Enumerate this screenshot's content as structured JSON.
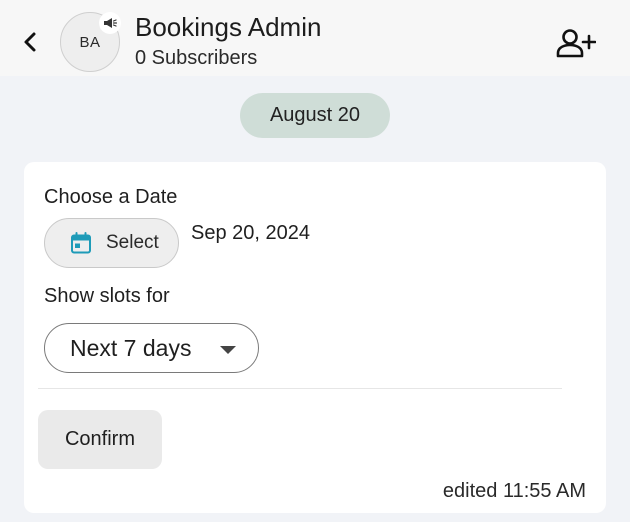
{
  "header": {
    "back_icon": "chevron-left-icon",
    "avatar_initials": "BA",
    "avatar_badge_icon": "megaphone-icon",
    "title": "Bookings Admin",
    "subtitle": "0 Subscribers",
    "add_user_icon": "add-user-icon"
  },
  "date_chip": {
    "label": "August 20"
  },
  "card": {
    "choose_date_label": "Choose a Date",
    "select_button": {
      "icon": "calendar-icon",
      "label": "Select"
    },
    "selected_date": "Sep 20, 2024",
    "show_slots_label": "Show slots for",
    "slots_dropdown": {
      "value": "Next 7 days"
    },
    "confirm_label": "Confirm",
    "edited_text": "edited 11:55 AM"
  },
  "colors": {
    "page_bg": "#f1f3f7",
    "header_bg": "#f7f7f7",
    "date_chip_bg": "#cfddd7",
    "calendar_icon": "#1e9bb8",
    "card_bg": "#ffffff"
  }
}
